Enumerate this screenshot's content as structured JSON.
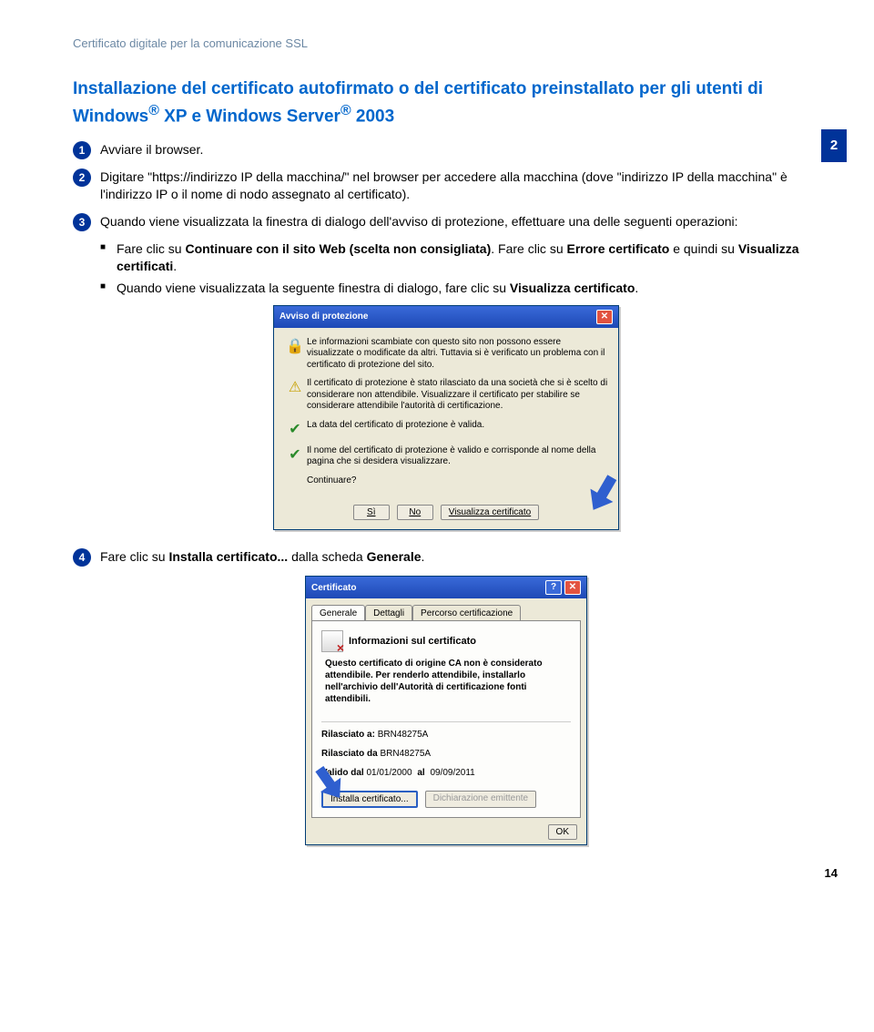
{
  "header": "Certificato digitale per la comunicazione SSL",
  "section_title_line1": "Installazione del certificato autofirmato o del certificato preinstallato per gli utenti di Windows",
  "section_title_sup1": "®",
  "section_title_mid": " XP e Windows Server",
  "section_title_sup2": "®",
  "section_title_end": " 2003",
  "side_chapter": "2",
  "steps": {
    "n1": "1",
    "t1": "Avviare il browser.",
    "n2": "2",
    "t2": "Digitare \"https://indirizzo IP della macchina/\" nel browser per accedere alla macchina (dove \"indirizzo IP della macchina\" è l'indirizzo IP o il nome di nodo assegnato al certificato).",
    "n3": "3",
    "t3": "Quando viene visualizzata la finestra di dialogo dell'avviso di protezione, effettuare una delle seguenti operazioni:",
    "n4": "4",
    "t4_a": "Fare clic su ",
    "t4_b": "Installa certificato...",
    "t4_c": " dalla scheda ",
    "t4_d": "Generale",
    "t4_e": "."
  },
  "bullets": {
    "b1_a": "Fare clic su ",
    "b1_b": "Continuare con il sito Web (scelta non consigliata)",
    "b1_c": ". Fare clic su ",
    "b1_d": "Errore certificato",
    "b1_e": " e quindi su ",
    "b1_f": "Visualizza certificati",
    "b1_g": ".",
    "b2_a": "Quando viene visualizzata la seguente finestra di dialogo, fare clic su ",
    "b2_b": "Visualizza certificato",
    "b2_c": "."
  },
  "alert": {
    "title": "Avviso di protezione",
    "intro": "Le informazioni scambiate con questo sito non possono essere visualizzate o modificate da altri. Tuttavia si è verificato un problema con il certificato di protezione del sito.",
    "row1": "Il certificato di protezione è stato rilasciato da una società che si è scelto di considerare non attendibile. Visualizzare il certificato per stabilire se considerare attendibile l'autorità di certificazione.",
    "row2": "La data del certificato di protezione è valida.",
    "row3": "Il nome del certificato di protezione è valido e corrisponde al nome della pagina che si desidera visualizzare.",
    "cont": "Continuare?",
    "btn_yes": "Sì",
    "btn_no": "No",
    "btn_view": "Visualizza certificato"
  },
  "cert": {
    "title": "Certificato",
    "tab1": "Generale",
    "tab2": "Dettagli",
    "tab3": "Percorso certificazione",
    "info_title": "Informazioni sul certificato",
    "info_body": "Questo certificato di origine CA non è considerato attendibile. Per renderlo attendibile, installarlo nell'archivio dell'Autorità di certificazione fonti attendibili.",
    "issued_to_lbl": "Rilasciato a:",
    "issued_to_val": "BRN48275A",
    "issued_by_lbl": "Rilasciato da",
    "issued_by_val": "BRN48275A",
    "valid_lbl": "Valido dal",
    "valid_from": "01/01/2000",
    "valid_mid": "al",
    "valid_to": "09/09/2011",
    "btn_install": "Installa certificato...",
    "btn_decl": "Dichiarazione emittente",
    "btn_ok": "OK"
  },
  "page_num": "14"
}
